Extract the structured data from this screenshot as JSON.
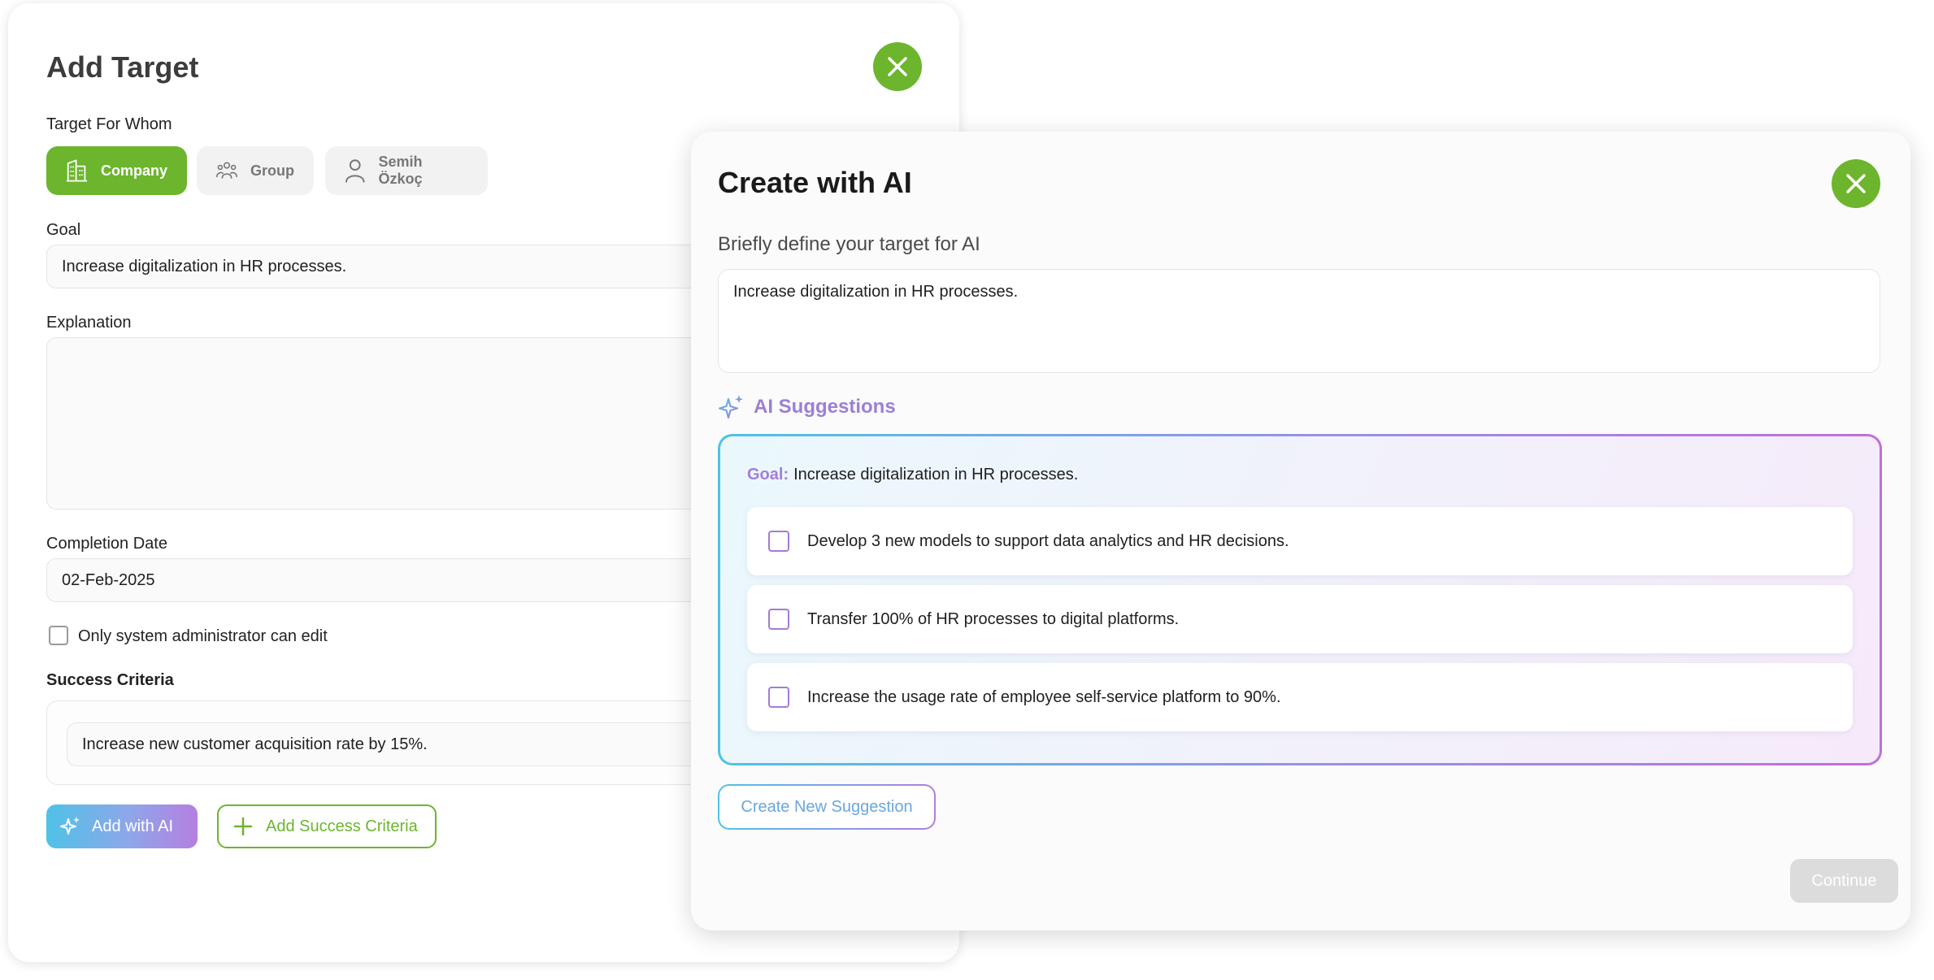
{
  "add_target": {
    "title": "Add Target",
    "target_for_whom_label": "Target For Whom",
    "whom_options": [
      {
        "label": "Company",
        "icon": "building-icon",
        "selected": true
      },
      {
        "label": "Group",
        "icon": "group-icon",
        "selected": false
      },
      {
        "label": "Semih Özkoç",
        "icon": "user-icon",
        "selected": false
      }
    ],
    "goal_label": "Goal",
    "goal_value": "Increase digitalization in HR processes.",
    "explanation_label": "Explanation",
    "explanation_value": "",
    "completion_date_label": "Completion Date",
    "completion_date_value": "02-Feb-2025",
    "admin_only_label": "Only system administrator can edit",
    "admin_only_checked": false,
    "success_criteria_label": "Success Criteria",
    "success_criteria": [
      "Increase new customer acquisition rate by 15%."
    ],
    "add_with_ai_label": "Add with AI",
    "add_success_criteria_label": "Add Success Criteria"
  },
  "create_with_ai": {
    "title": "Create with AI",
    "prompt_label": "Briefly define your target for AI",
    "prompt_value": "Increase digitalization in HR processes.",
    "suggestions_heading": "AI Suggestions",
    "goal_prefix": "Goal:",
    "goal_text": "Increase digitalization in HR processes.",
    "suggestions": [
      {
        "text": "Develop 3 new models to support data analytics and HR decisions.",
        "checked": false
      },
      {
        "text": "Transfer 100% of HR processes to digital platforms.",
        "checked": false
      },
      {
        "text": "Increase the usage rate of employee self-service platform to 90%.",
        "checked": false
      }
    ],
    "create_new_suggestion_label": "Create New Suggestion",
    "continue_label": "Continue"
  },
  "colors": {
    "brand_green": "#6cb52d",
    "ai_purple": "#9b7fd6",
    "ai_blue": "#4ec3e4",
    "disabled_gray": "#dcdcdc"
  }
}
